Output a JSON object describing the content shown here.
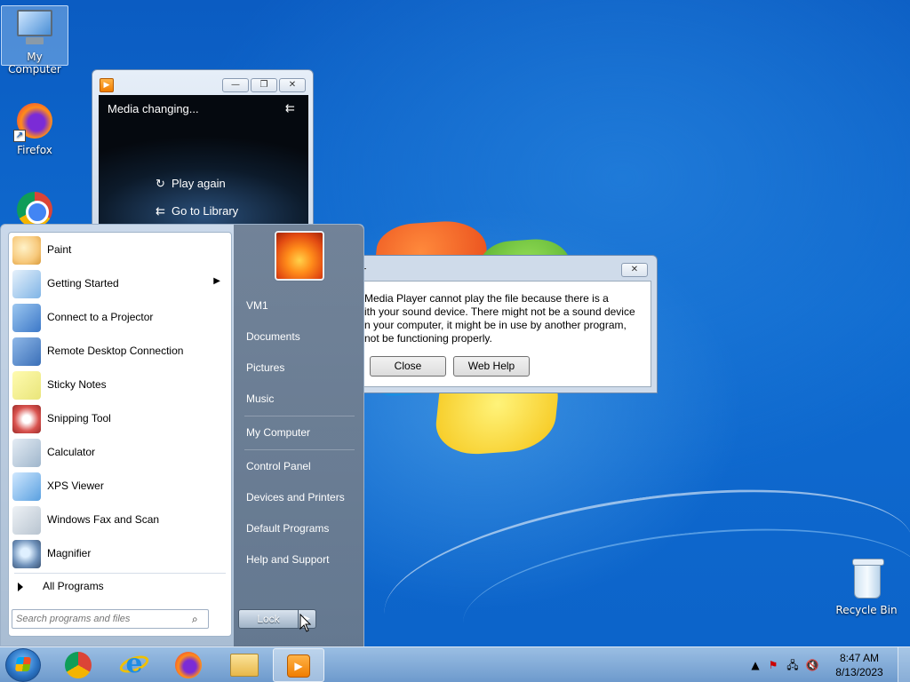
{
  "desktop": {
    "icons": [
      {
        "label": "My Computer",
        "icon": "computer-icon"
      },
      {
        "label": "Firefox",
        "icon": "firefox-icon"
      },
      {
        "label": "Recycle Bin",
        "icon": "recycle-bin-icon"
      }
    ]
  },
  "media_player": {
    "status_text": "Media changing...",
    "play_again": "Play again",
    "go_to_library": "Go to Library"
  },
  "error_dialog": {
    "title": "r",
    "message_lines": [
      "Media Player cannot play the file because there is a",
      "ith your sound device. There might not be a sound device",
      "n your computer, it might be in use by another program,",
      " not be functioning properly."
    ],
    "close_label": "Close",
    "web_help_label": "Web Help"
  },
  "start_menu": {
    "programs": [
      {
        "label": "Paint",
        "icon": "paint-icon",
        "color": "#f7c97c",
        "submenu": false
      },
      {
        "label": "Getting Started",
        "icon": "getting-started-icon",
        "color": "#7fb4e6",
        "submenu": true
      },
      {
        "label": "Connect to a Projector",
        "icon": "projector-icon",
        "color": "#3c78c8",
        "submenu": false
      },
      {
        "label": "Remote Desktop Connection",
        "icon": "remote-desktop-icon",
        "color": "#3a6fb8",
        "submenu": false
      },
      {
        "label": "Sticky Notes",
        "icon": "sticky-notes-icon",
        "color": "#e9e57a",
        "submenu": false
      },
      {
        "label": "Snipping Tool",
        "icon": "snipping-tool-icon",
        "color": "#d9534f",
        "submenu": false
      },
      {
        "label": "Calculator",
        "icon": "calculator-icon",
        "color": "#9fb6cc",
        "submenu": false
      },
      {
        "label": "XPS Viewer",
        "icon": "xps-viewer-icon",
        "color": "#5aa0e0",
        "submenu": false
      },
      {
        "label": "Windows Fax and Scan",
        "icon": "fax-scan-icon",
        "color": "#b8c4d0",
        "submenu": false
      },
      {
        "label": "Magnifier",
        "icon": "magnifier-icon",
        "color": "#6d8fb8",
        "submenu": false
      }
    ],
    "all_programs": "All Programs",
    "search_placeholder": "Search programs and files",
    "right_links": [
      "VM1",
      "Documents",
      "Pictures",
      "Music",
      "My Computer",
      "Control Panel",
      "Devices and Printers",
      "Default Programs",
      "Help and Support"
    ],
    "lock_label": "Lock"
  },
  "taskbar": {
    "pinned": [
      "start-orb",
      "chrome-icon",
      "internet-explorer-icon",
      "firefox-icon",
      "explorer-folder-icon",
      "windows-media-player-icon"
    ],
    "clock_time": "8:47 AM",
    "clock_date": "8/13/2023"
  }
}
